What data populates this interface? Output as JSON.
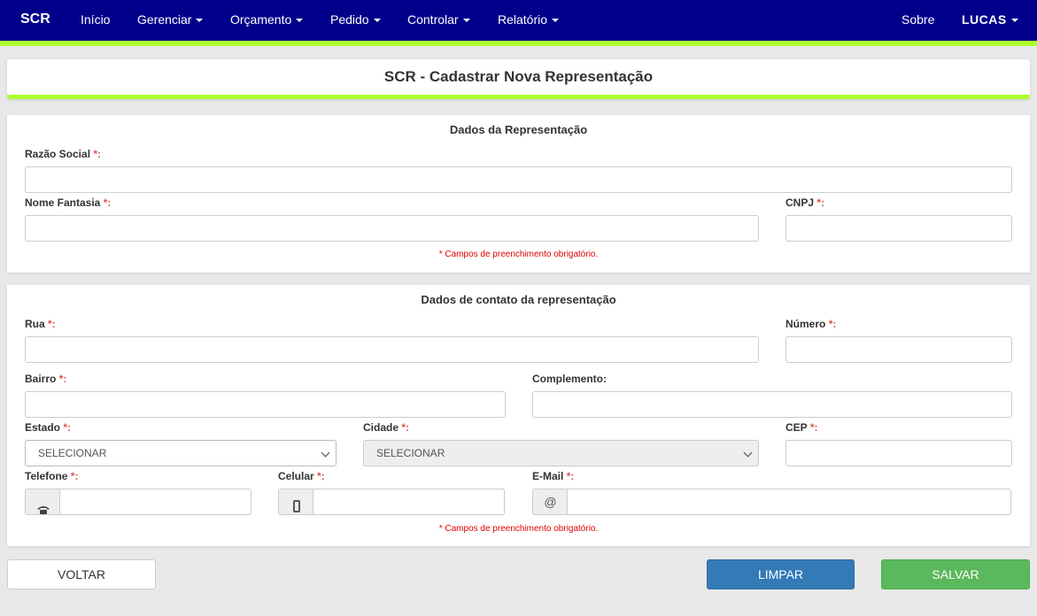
{
  "navbar": {
    "brand": "SCR",
    "items": [
      "Início",
      "Gerenciar",
      "Orçamento",
      "Pedido",
      "Controlar",
      "Relatório"
    ],
    "about": "Sobre",
    "user": "LUCAS"
  },
  "page": {
    "title": "SCR - Cadastrar Nova Representação"
  },
  "section1": {
    "heading": "Dados da Representação",
    "razao_social_label": "Razão Social",
    "nome_fantasia_label": "Nome Fantasia",
    "cnpj_label": "CNPJ",
    "required_mark": "*:",
    "note": "* Campos de preenchimento obrigatório."
  },
  "section2": {
    "heading": "Dados de contato da representação",
    "rua_label": "Rua",
    "numero_label": "Número",
    "bairro_label": "Bairro",
    "complemento_label": "Complemento:",
    "estado_label": "Estado",
    "cidade_label": "Cidade",
    "cep_label": "CEP",
    "telefone_label": "Telefone",
    "celular_label": "Celular",
    "email_label": "E-Mail",
    "estado_value": "SELECIONAR",
    "cidade_value": "SELECIONAR",
    "email_addon": "@",
    "note": "* Campos de preenchimento obrigatório."
  },
  "buttons": {
    "back": "VOLTAR",
    "clear": "LIMPAR",
    "save": "SALVAR"
  },
  "colors": {
    "navbar": "#00008b",
    "accent": "#adff2f",
    "clear_button": "#337ab7",
    "save_button": "#5cb85c",
    "required": "#d9534f"
  }
}
